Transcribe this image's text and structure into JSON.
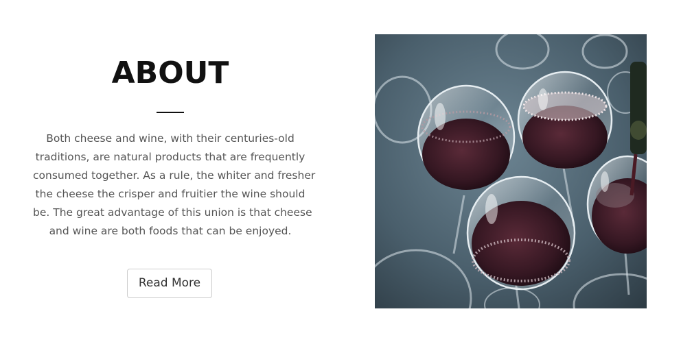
{
  "about": {
    "title": "ABOUT",
    "paragraph_lines": [
      "Both cheese and wine, with their centuries-old",
      "traditions, are natural products that are frequently",
      "consumed together. As a rule, the whiter and fresher",
      "the cheese the crisper and fruitier the wine should",
      "be. The great advantage of this union is that cheese",
      "and wine are both foods that can be enjoyed."
    ],
    "button_label": "Read More"
  },
  "photo": {
    "subject": "red-wine-glasses-photo",
    "colors": {
      "background": "#4a5f6c",
      "wine": "#3a1a24",
      "glass_highlight": "#e6edf1"
    }
  }
}
